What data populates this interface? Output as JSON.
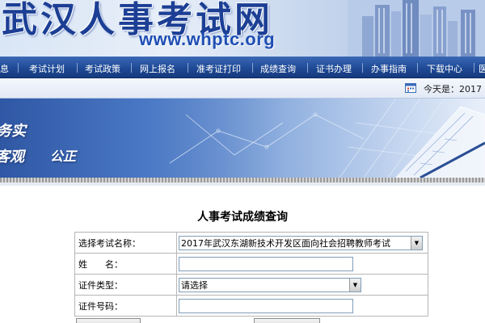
{
  "banner": {
    "site_name": "武汉人事考试网",
    "site_url": "www.whptc.org"
  },
  "nav": {
    "items": [
      {
        "label": "息"
      },
      {
        "label": "考试计划"
      },
      {
        "label": "考试政策"
      },
      {
        "label": "网上报名"
      },
      {
        "label": "准考证打印"
      },
      {
        "label": "成绩查询"
      },
      {
        "label": "证书办理"
      },
      {
        "label": "办事指南"
      },
      {
        "label": "下载中心"
      },
      {
        "label": "医"
      }
    ]
  },
  "datebar": {
    "today_label": "今天是：2017"
  },
  "subbanner": {
    "slogan_1": "务实",
    "slogan_2": "客观",
    "slogan_3": "公正"
  },
  "form": {
    "title": "人事考试成绩查询",
    "exam_name_label": "选择考试名称：",
    "exam_name_value": "2017年武汉东湖新技术开发区面向社会招聘教师考试",
    "name_label": "姓　　名：",
    "name_value": "",
    "id_type_label": "证件类型：",
    "id_type_value": "请选择",
    "id_number_label": "证件号码：",
    "id_number_value": ""
  },
  "colors": {
    "nav_bg": "#1f4a96",
    "banner_text": "#1c3f95"
  }
}
